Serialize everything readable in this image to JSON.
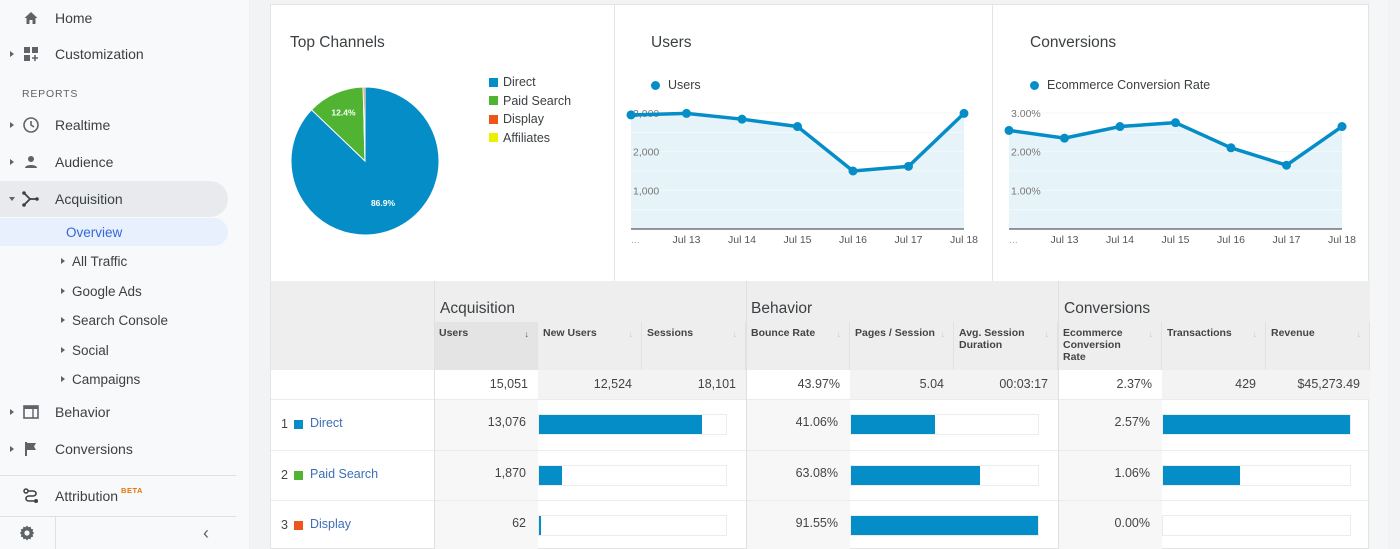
{
  "sidebar": {
    "items_top": [
      {
        "label": "Home",
        "icon": "home-icon"
      },
      {
        "label": "Customization",
        "icon": "dashboard-plus-icon"
      }
    ],
    "section_label": "REPORTS",
    "items": [
      {
        "label": "Realtime",
        "icon": "clock-icon"
      },
      {
        "label": "Audience",
        "icon": "person-icon"
      },
      {
        "label": "Acquisition",
        "icon": "acquisition-icon",
        "expanded": true
      },
      {
        "label": "Behavior",
        "icon": "browser-window-icon"
      },
      {
        "label": "Conversions",
        "icon": "flag-icon"
      }
    ],
    "acquisition_sub": [
      {
        "label": "Overview",
        "selected": true
      },
      {
        "label": "All Traffic"
      },
      {
        "label": "Google Ads"
      },
      {
        "label": "Search Console"
      },
      {
        "label": "Social"
      },
      {
        "label": "Campaigns"
      }
    ],
    "attribution": {
      "label": "Attribution",
      "badge": "BETA"
    },
    "footer": {
      "settings_icon": "gear-icon",
      "collapse_icon": "chevron-left-icon",
      "collapse_glyph": "‹"
    }
  },
  "cards": {
    "top_channels": {
      "title": "Top Channels",
      "legend": [
        {
          "label": "Direct",
          "color": "#058dc7"
        },
        {
          "label": "Paid Search",
          "color": "#50b432"
        },
        {
          "label": "Display",
          "color": "#ed561b"
        },
        {
          "label": "Affiliates",
          "color": "#edef00"
        }
      ],
      "slice_labels": {
        "direct": "86.9%",
        "paid_search": "12.4%"
      }
    },
    "users": {
      "title": "Users",
      "legend": "Users"
    },
    "conversions": {
      "title": "Conversions",
      "legend": "Ecommerce Conversion Rate"
    }
  },
  "chart_data": [
    {
      "type": "pie",
      "title": "Top Channels",
      "categories": [
        "Direct",
        "Paid Search",
        "Display",
        "Affiliates"
      ],
      "values": [
        86.9,
        12.4,
        0.4,
        0.0
      ],
      "colors": [
        "#058dc7",
        "#50b432",
        "#ed561b",
        "#edef00"
      ],
      "data_labels": [
        "86.9%",
        "12.4%",
        "",
        ""
      ],
      "legend": "right"
    },
    {
      "type": "area",
      "title": "Users",
      "x": [
        "...",
        "Jul 13",
        "Jul 14",
        "Jul 15",
        "Jul 16",
        "Jul 17",
        "Jul 18"
      ],
      "series": [
        {
          "name": "Users",
          "values": [
            2950,
            2990,
            2840,
            2650,
            1500,
            1620,
            2990
          ],
          "color": "#058dc7"
        }
      ],
      "yticks": [
        "1,000",
        "2,000",
        "3,000"
      ],
      "ylim": [
        0,
        3000
      ],
      "grid": true,
      "legend": "top-left"
    },
    {
      "type": "area",
      "title": "Conversions",
      "x": [
        "...",
        "Jul 13",
        "Jul 14",
        "Jul 15",
        "Jul 16",
        "Jul 17",
        "Jul 18"
      ],
      "series": [
        {
          "name": "Ecommerce Conversion Rate",
          "values": [
            2.55,
            2.35,
            2.65,
            2.75,
            2.1,
            1.65,
            2.65
          ],
          "color": "#058dc7"
        }
      ],
      "yticks": [
        "1.00%",
        "2.00%",
        "3.00%"
      ],
      "ylim": [
        0,
        3.0
      ],
      "grid": true,
      "legend": "top-left"
    }
  ],
  "table": {
    "groups": [
      "Acquisition",
      "Behavior",
      "Conversions"
    ],
    "columns": [
      {
        "label": "Users",
        "sorted": true
      },
      {
        "label": "New Users"
      },
      {
        "label": "Sessions"
      },
      {
        "label": "Bounce Rate"
      },
      {
        "label": "Pages / Session"
      },
      {
        "label": "Avg. Session Duration"
      },
      {
        "label": "Ecommerce Conversion Rate"
      },
      {
        "label": "Transactions"
      },
      {
        "label": "Revenue"
      }
    ],
    "sort_icon": "↓",
    "totals": [
      "15,051",
      "12,524",
      "18,101",
      "43.97%",
      "5.04",
      "00:03:17",
      "2.37%",
      "429",
      "$45,273.49"
    ],
    "rows": [
      {
        "num": "1",
        "name": "Direct",
        "color": "#058dc7",
        "users": "13,076",
        "users_frac": 0.869,
        "bounce": "41.06%",
        "bounce_frac": 0.4485,
        "conv": "2.57%",
        "conv_frac": 1.0
      },
      {
        "num": "2",
        "name": "Paid Search",
        "color": "#50b432",
        "users": "1,870",
        "users_frac": 0.124,
        "bounce": "63.08%",
        "bounce_frac": 0.689,
        "conv": "1.06%",
        "conv_frac": 0.4125
      },
      {
        "num": "3",
        "name": "Display",
        "color": "#ed561b",
        "users": "62",
        "users_frac": 0.004,
        "bounce": "91.55%",
        "bounce_frac": 1.0,
        "conv": "0.00%",
        "conv_frac": 0.0
      }
    ]
  }
}
